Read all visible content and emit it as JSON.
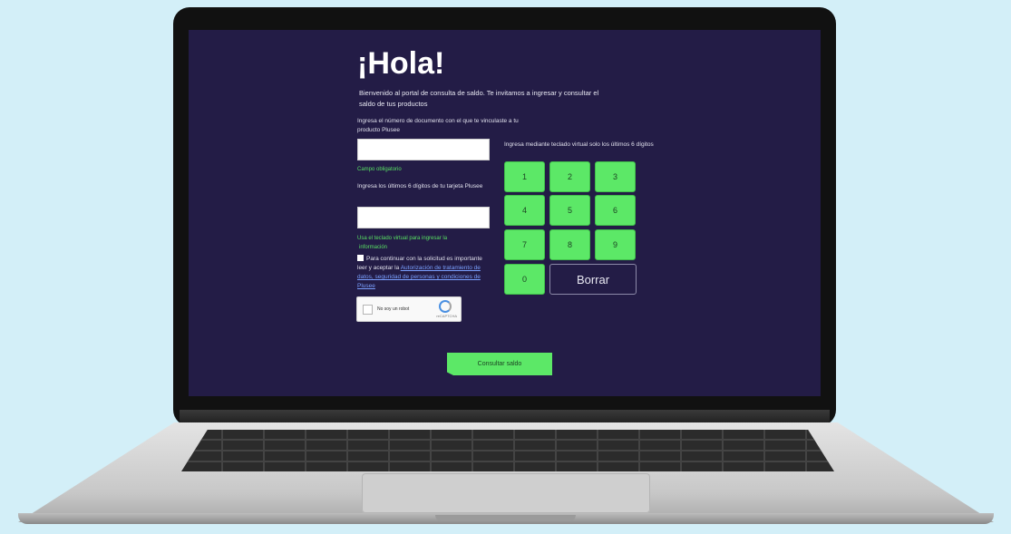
{
  "page": {
    "title": "¡Hola!",
    "intro": "Bienvenido al portal de consulta de saldo. Te invitamos a ingresar y consultar el saldo de tus productos",
    "doc_label": "Ingresa el número de documento con el que te vinculaste a tu producto Plusee",
    "doc_value": "",
    "doc_help": "Campo obligatorio",
    "card_label": "Ingresa los últimos 6 dígitos de tu tarjeta Plusee",
    "card_value": "",
    "card_help_1": "Usa el teclado virtual para ingresar la",
    "card_help_2": "información",
    "consent_text": "Para continuar con la solicitud es importante leer y aceptar la",
    "consent_link": "Autorización de tratamiento de datos, seguridad de personas y condiciones de Plusee",
    "captcha_text": "No soy un robot",
    "captcha_brand": "reCAPTCHA"
  },
  "keypad": {
    "label": "Ingresa mediante teclado virtual solo los últimos 6 dígitos",
    "keys": [
      "1",
      "2",
      "3",
      "4",
      "5",
      "6",
      "7",
      "8",
      "9",
      "0"
    ],
    "clear_label": "Borrar"
  },
  "actions": {
    "submit_label": "Consultar saldo"
  },
  "colors": {
    "screen_bg": "#231c46",
    "accent": "#5ce867",
    "page_bg": "#d3eff8"
  }
}
